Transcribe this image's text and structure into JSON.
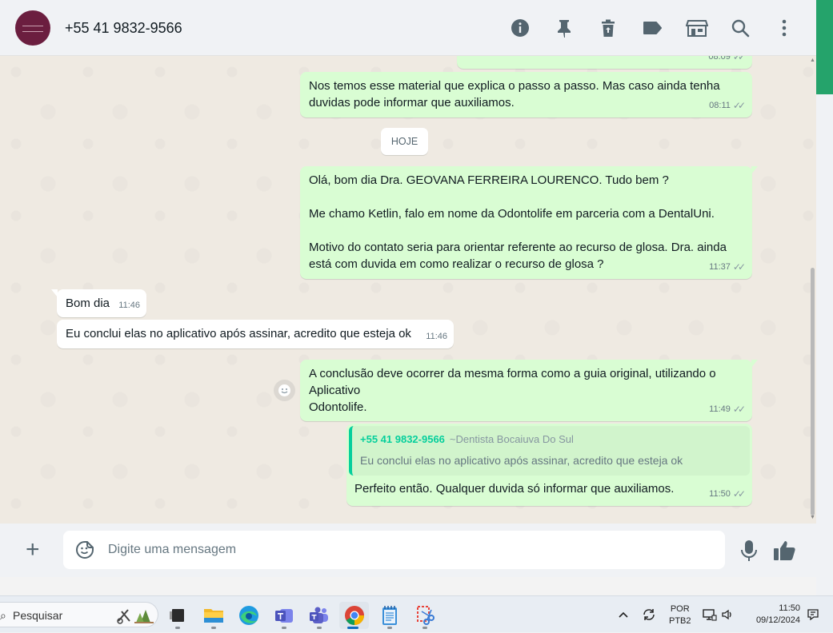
{
  "header": {
    "contact_name": "+55 41 9832-9566",
    "icons": [
      "info-icon",
      "pin-icon",
      "delete-icon",
      "label-icon",
      "catalog-icon",
      "search-icon",
      "menu-icon"
    ]
  },
  "messages": {
    "m0_time": "08:09",
    "m1": {
      "text": "Nos temos esse material que explica o passo a passo. Mas caso ainda tenha\nduvidas pode informar que auxiliamos.",
      "time": "08:11"
    },
    "date_chip": "HOJE",
    "m2": {
      "text": "Olá, bom dia Dra. GEOVANA FERREIRA LOURENCO. Tudo bem ?\n\nMe chamo Ketlin, falo em nome da Odontolife em parceria com a DentalUni.\n\nMotivo do contato seria para orientar referente ao recurso de glosa. Dra. ainda\nestá com duvida em como realizar o recurso de glosa ?",
      "time": "11:37"
    },
    "m3": {
      "text": "Bom dia",
      "time": "11:46"
    },
    "m4": {
      "text": "Eu conclui elas no aplicativo após assinar, acredito que esteja ok",
      "time": "11:46"
    },
    "m5": {
      "text": "A conclusão deve ocorrer da mesma forma como a guia original, utilizando o\nAplicativo\nOdontolife.",
      "time": "11:49"
    },
    "m6": {
      "quote_sender": "+55 41 9832-9566",
      "quote_pushname": "~Dentista Bocaiuva Do Sul",
      "quote_text": "Eu conclui elas no aplicativo após assinar, acredito que esteja ok",
      "text": "Perfeito então. Qualquer duvida só informar que auxiliamos.",
      "time": "11:50"
    }
  },
  "composer": {
    "placeholder": "Digite uma mensagem"
  },
  "taskbar": {
    "search_label": "Pesquisar",
    "lang_line1": "POR",
    "lang_line2": "PTB2",
    "time": "11:50",
    "date": "09/12/2024"
  },
  "colors": {
    "outgoing_bubble": "#d9fdd3",
    "incoming_bubble": "#ffffff",
    "chat_background": "#efeae2",
    "quote_accent": "#06cf9c"
  }
}
